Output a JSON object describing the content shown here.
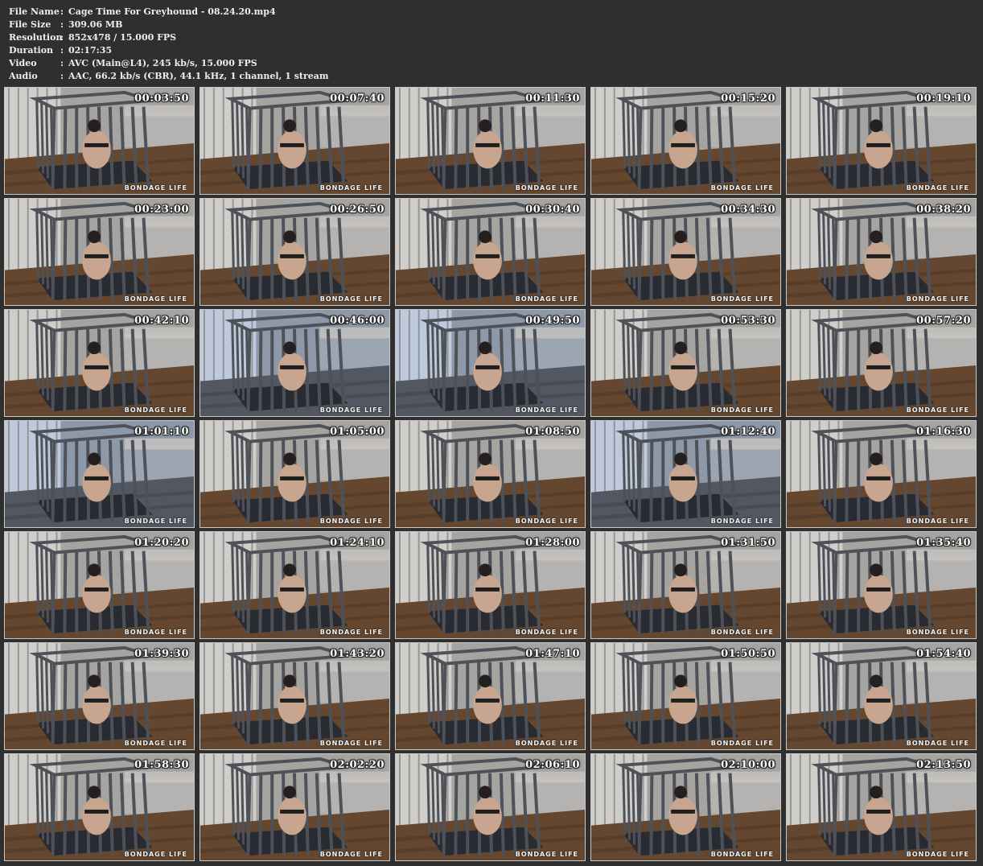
{
  "info": [
    {
      "label": "File Name",
      "colon": ":",
      "value": "Cage Time For Greyhound - 08.24.20.mp4"
    },
    {
      "label": "File Size",
      "colon": ":",
      "value": "309.06 MB"
    },
    {
      "label": "Resolution",
      "colon": ":",
      "value": "852x478 / 15.000 FPS"
    },
    {
      "label": "Duration",
      "colon": ":",
      "value": "02:17:35"
    },
    {
      "label": "Video",
      "colon": ":",
      "value": "AVC (Main@L4), 245 kb/s, 15.000 FPS"
    },
    {
      "label": "Audio",
      "colon": ":",
      "value": "AAC, 66.2 kb/s (CBR), 44.1 kHz, 1 channel, 1 stream"
    }
  ],
  "watermark_text": "BONDAGE LIFE",
  "thumbnails": [
    {
      "time": "00:03:50",
      "tint": "warm"
    },
    {
      "time": "00:07:40",
      "tint": "warm"
    },
    {
      "time": "00:11:30",
      "tint": "warm"
    },
    {
      "time": "00:15:20",
      "tint": "warm"
    },
    {
      "time": "00:19:10",
      "tint": "warm"
    },
    {
      "time": "00:23:00",
      "tint": "warm"
    },
    {
      "time": "00:26:50",
      "tint": "warm"
    },
    {
      "time": "00:30:40",
      "tint": "warm"
    },
    {
      "time": "00:34:30",
      "tint": "warm"
    },
    {
      "time": "00:38:20",
      "tint": "warm"
    },
    {
      "time": "00:42:10",
      "tint": "warm"
    },
    {
      "time": "00:46:00",
      "tint": "cool"
    },
    {
      "time": "00:49:50",
      "tint": "cool"
    },
    {
      "time": "00:53:30",
      "tint": "warm"
    },
    {
      "time": "00:57:20",
      "tint": "warm"
    },
    {
      "time": "01:01:10",
      "tint": "cool"
    },
    {
      "time": "01:05:00",
      "tint": "warm"
    },
    {
      "time": "01:08:50",
      "tint": "warm"
    },
    {
      "time": "01:12:40",
      "tint": "cool"
    },
    {
      "time": "01:16:30",
      "tint": "warm"
    },
    {
      "time": "01:20:20",
      "tint": "warm"
    },
    {
      "time": "01:24:10",
      "tint": "warm"
    },
    {
      "time": "01:28:00",
      "tint": "warm"
    },
    {
      "time": "01:31:50",
      "tint": "warm"
    },
    {
      "time": "01:35:40",
      "tint": "warm"
    },
    {
      "time": "01:39:30",
      "tint": "warm"
    },
    {
      "time": "01:43:20",
      "tint": "warm"
    },
    {
      "time": "01:47:10",
      "tint": "warm"
    },
    {
      "time": "01:50:50",
      "tint": "warm"
    },
    {
      "time": "01:54:40",
      "tint": "warm"
    },
    {
      "time": "01:58:30",
      "tint": "warm"
    },
    {
      "time": "02:02:20",
      "tint": "warm"
    },
    {
      "time": "02:06:10",
      "tint": "warm"
    },
    {
      "time": "02:10:00",
      "tint": "warm"
    },
    {
      "time": "02:13:50",
      "tint": "warm"
    }
  ],
  "colors": {
    "background": "#2f2f2f",
    "header_text": "#eeeeee",
    "thumb_border": "#c9c9c9",
    "cage_bar": "#555a60",
    "floor_warm": "#6e4e34",
    "floor_cool": "#5a5f6a",
    "cage_mat": "#2c2f36"
  }
}
